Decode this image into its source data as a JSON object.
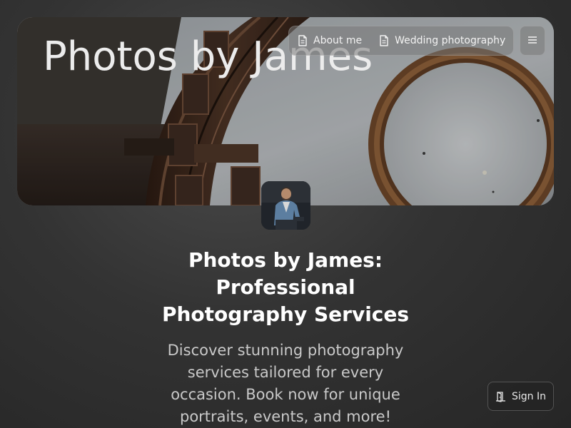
{
  "hero": {
    "title": "Photos by James"
  },
  "nav": {
    "items": [
      {
        "label": "About me",
        "icon": "document-icon"
      },
      {
        "label": "Wedding photography",
        "icon": "document-icon"
      }
    ],
    "menu_icon": "hamburger-menu-icon"
  },
  "profile": {
    "avatar_alt": "James"
  },
  "main": {
    "headline_line1": "Photos by James:",
    "headline_line2": "Professional",
    "headline_line3": "Photography Services",
    "subtext_line1": "Discover stunning photography",
    "subtext_line2": "services tailored for every",
    "subtext_line3": "occasion. Book now for unique",
    "subtext_line4": "portraits, events, and more!"
  },
  "auth": {
    "signin_label": "Sign In",
    "signin_icon": "door-icon"
  },
  "colors": {
    "background": "#333333",
    "headline": "#ffffff",
    "subtext": "#c9c9c9"
  }
}
